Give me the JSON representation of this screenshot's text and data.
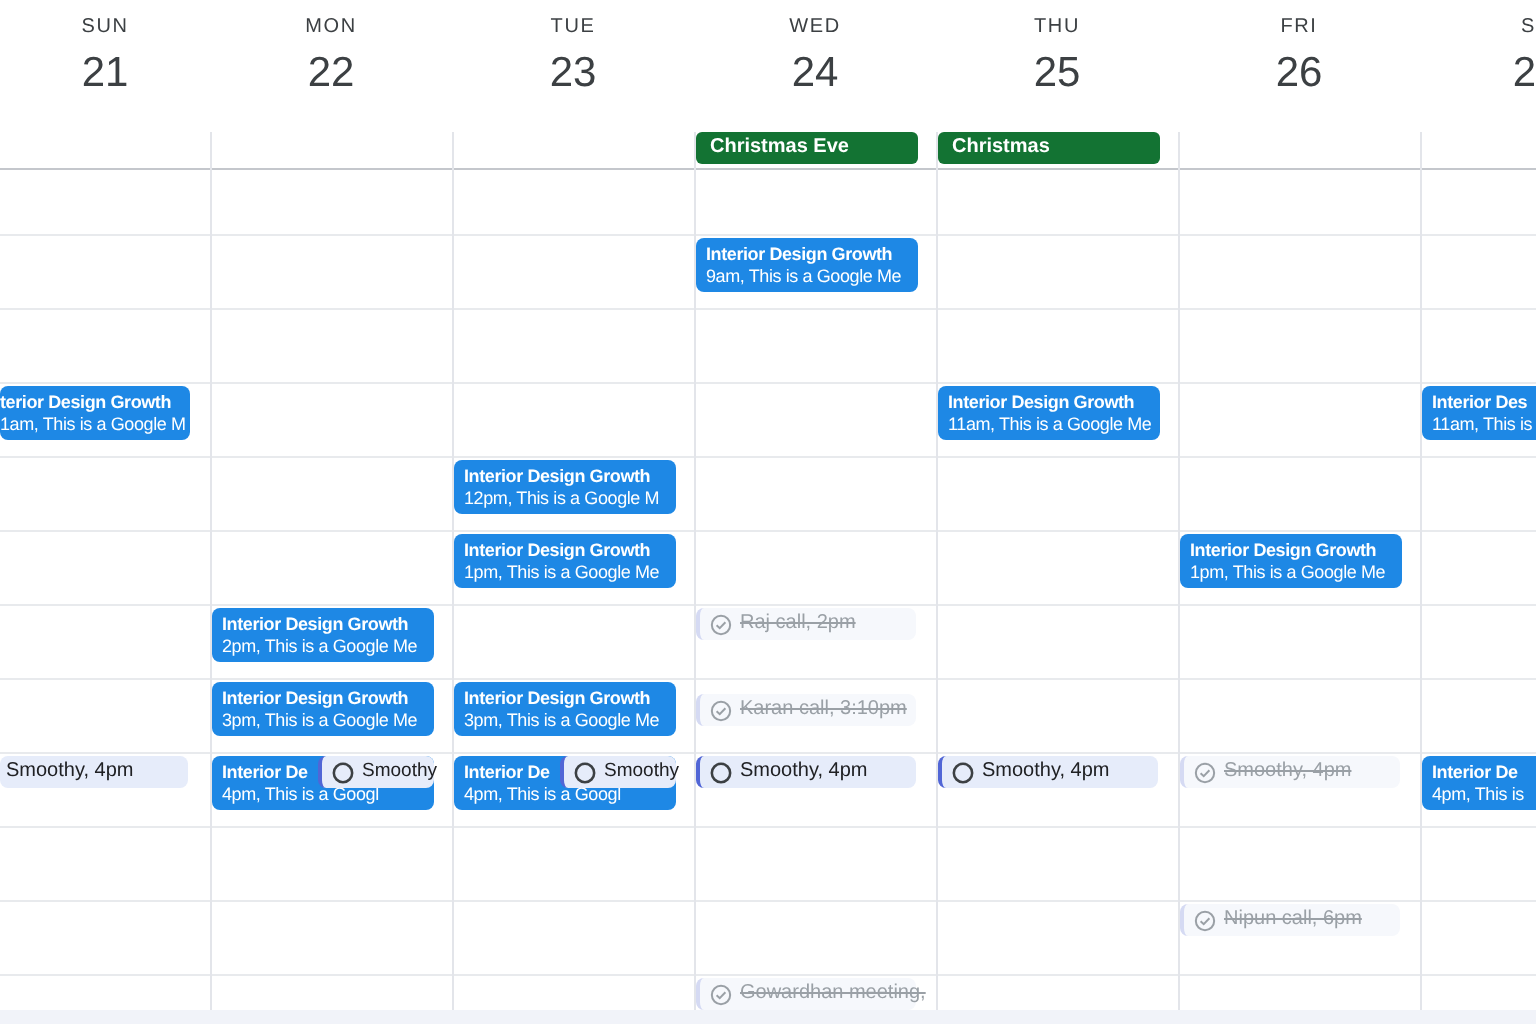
{
  "days": [
    {
      "label": "SUN",
      "date": "21",
      "events": [
        {
          "kind": "meeting",
          "title": "terior Design Growth",
          "detail": "1am, This is a Google M"
        },
        {
          "kind": "task",
          "title": "Smoothy, 4pm",
          "done": false
        }
      ]
    },
    {
      "label": "MON",
      "date": "22",
      "events": [
        {
          "kind": "meeting",
          "title": "Interior Design Growth",
          "detail": "2pm, This is a Google Me"
        },
        {
          "kind": "meeting",
          "title": "Interior Design Growth",
          "detail": "3pm, This is a Google Me"
        },
        {
          "kind": "meeting",
          "title": "Interior De",
          "detail": "4pm, This is a Googl"
        },
        {
          "kind": "task",
          "title": "Smoothy",
          "done": false
        }
      ]
    },
    {
      "label": "TUE",
      "date": "23",
      "events": [
        {
          "kind": "meeting",
          "title": "Interior Design Growth",
          "detail": "12pm, This is a Google M"
        },
        {
          "kind": "meeting",
          "title": "Interior Design Growth",
          "detail": "1pm, This is a Google Me"
        },
        {
          "kind": "meeting",
          "title": "Interior Design Growth",
          "detail": "3pm, This is a Google Me"
        },
        {
          "kind": "meeting",
          "title": "Interior De",
          "detail": "4pm, This is a Googl"
        },
        {
          "kind": "task",
          "title": "Smoothy",
          "done": false
        }
      ]
    },
    {
      "label": "WED",
      "date": "24",
      "holidays": [
        {
          "title": "Christmas Eve"
        }
      ],
      "events": [
        {
          "kind": "meeting",
          "title": "Interior Design Growth",
          "detail": "9am, This is a Google Me"
        },
        {
          "kind": "task",
          "title": "Raj call, 2pm",
          "done": true
        },
        {
          "kind": "task",
          "title": "Karan call, 3:10pm",
          "done": true
        },
        {
          "kind": "task",
          "title": "Smoothy, 4pm",
          "done": false
        },
        {
          "kind": "task",
          "title": "Gowardhan meeting,",
          "done": true
        }
      ]
    },
    {
      "label": "THU",
      "date": "25",
      "holidays": [
        {
          "title": "Christmas"
        }
      ],
      "events": [
        {
          "kind": "meeting",
          "title": "Interior Design Growth",
          "detail": "11am, This is a Google Me"
        },
        {
          "kind": "task",
          "title": "Smoothy, 4pm",
          "done": false
        }
      ]
    },
    {
      "label": "FRI",
      "date": "26",
      "events": [
        {
          "kind": "meeting",
          "title": "Interior Design Growth",
          "detail": "1pm, This is a Google Me"
        },
        {
          "kind": "task",
          "title": "Smoothy, 4pm",
          "done": true
        },
        {
          "kind": "task",
          "title": "Nipun call, 6pm",
          "done": true
        }
      ]
    },
    {
      "label": "S",
      "date": "2",
      "events": [
        {
          "kind": "meeting",
          "title": "Interior Des",
          "detail": "11am, This is"
        },
        {
          "kind": "meeting",
          "title": "Interior De",
          "detail": "4pm, This is"
        }
      ]
    }
  ]
}
